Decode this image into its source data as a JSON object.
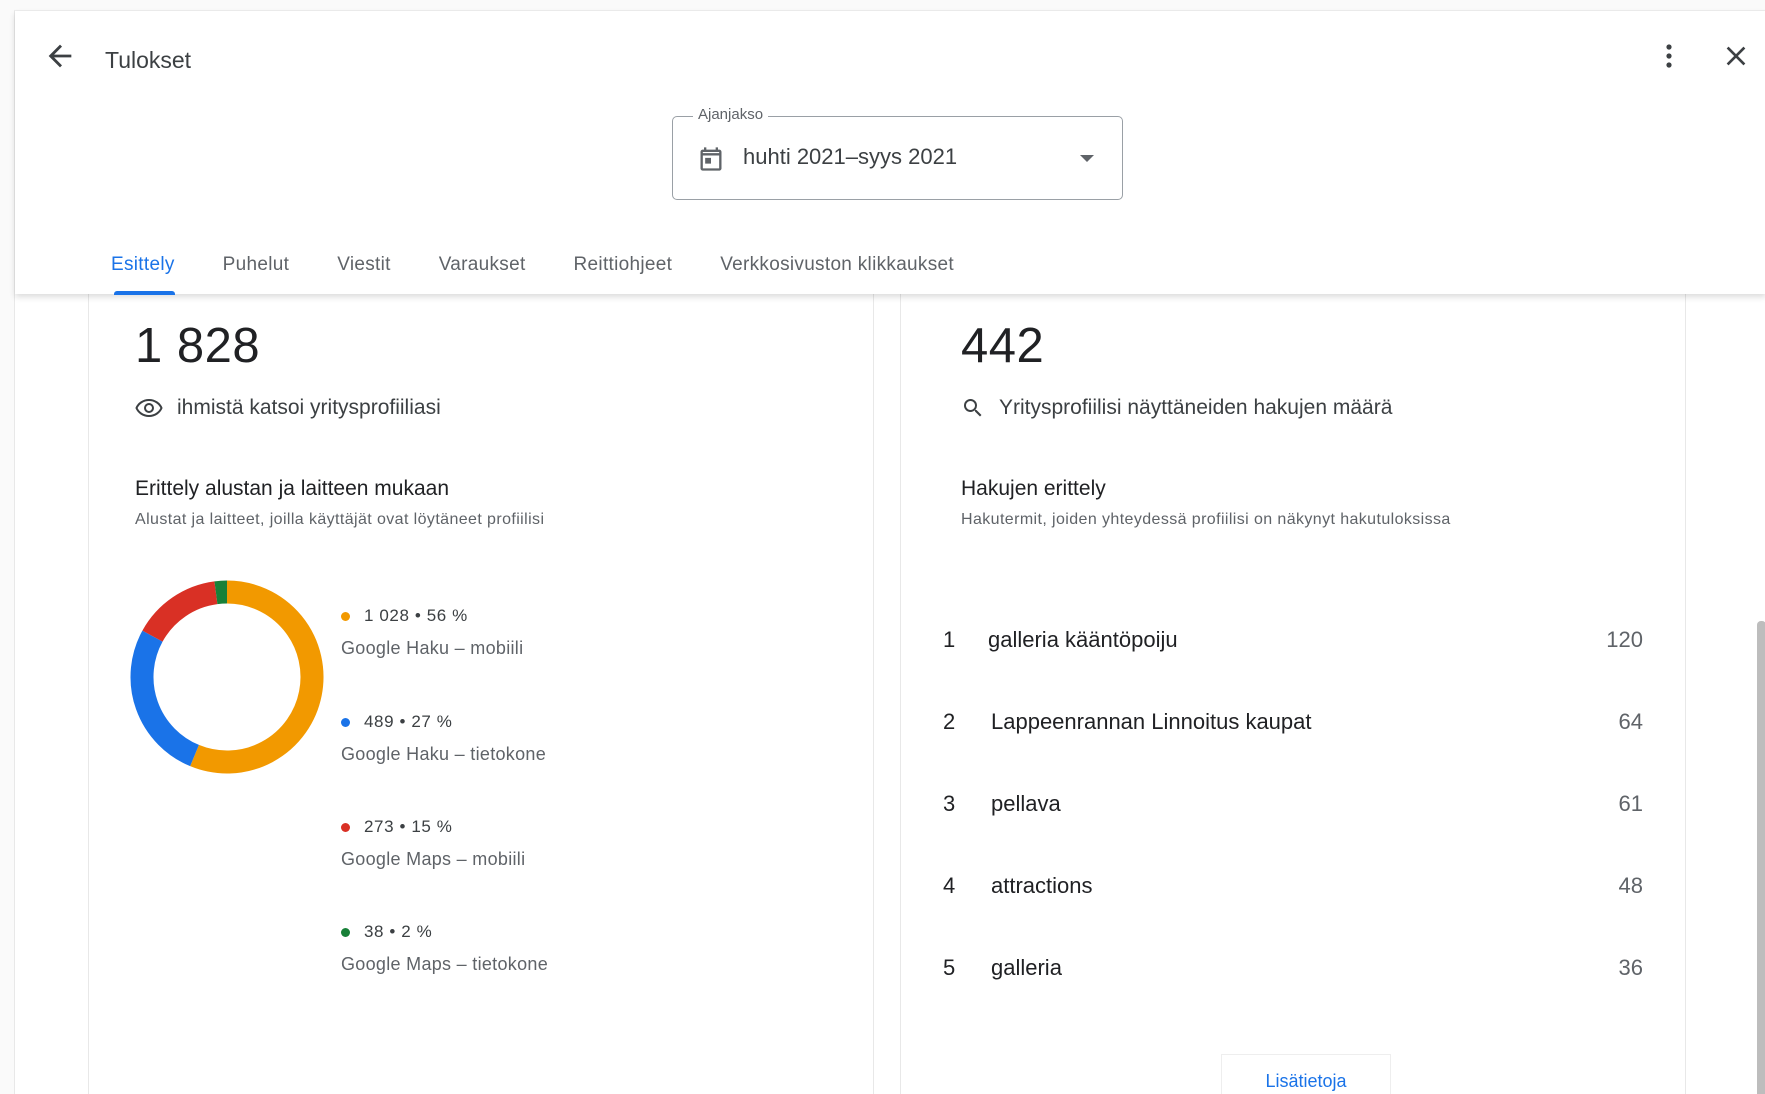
{
  "header": {
    "title": "Tulokset"
  },
  "period": {
    "label": "Ajanjakso",
    "value": "huhti 2021–syys 2021"
  },
  "tabs": [
    {
      "label": "Esittely",
      "active": true
    },
    {
      "label": "Puhelut",
      "active": false
    },
    {
      "label": "Viestit",
      "active": false
    },
    {
      "label": "Varaukset",
      "active": false
    },
    {
      "label": "Reittiohjeet",
      "active": false
    },
    {
      "label": "Verkkosivuston klikkaukset",
      "active": false
    }
  ],
  "profile_views": {
    "total": "1 828",
    "caption": "ihmistä katsoi yritysprofiiliasi",
    "breakdown_title": "Erittely alustan ja laitteen mukaan",
    "breakdown_subtitle": "Alustat ja laitteet, joilla käyttäjät ovat löytäneet profiilisi"
  },
  "searches": {
    "total": "442",
    "caption": "Yritysprofiilisi näyttäneiden hakujen määrä",
    "breakdown_title": "Hakujen erittely",
    "breakdown_subtitle": "Hakutermit, joiden yhteydessä profiilisi on näkynyt hakutuloksissa",
    "rows": [
      {
        "rank": "1",
        "term": "galleria kääntöpoiju",
        "count": "120"
      },
      {
        "rank": "2",
        "term": "Lappeenrannan Linnoitus kaupat",
        "count": "64"
      },
      {
        "rank": "3",
        "term": "pellava",
        "count": "61"
      },
      {
        "rank": "4",
        "term": "attractions",
        "count": "48"
      },
      {
        "rank": "5",
        "term": "galleria",
        "count": "36"
      }
    ],
    "more_link": "Lisätietoja"
  },
  "chart_data": {
    "type": "pie",
    "donut": true,
    "categories": [
      "Google Haku – mobiili",
      "Google Haku – tietokone",
      "Google Maps – mobiili",
      "Google Maps – tietokone"
    ],
    "values": [
      1028,
      489,
      273,
      38
    ],
    "percent": [
      56,
      27,
      15,
      2
    ],
    "value_labels": [
      "1 028 • 56 %",
      "489 • 27 %",
      "273 • 15 %",
      "38 • 2 %"
    ],
    "colors": [
      "#f29900",
      "#1a73e8",
      "#d93025",
      "#188038"
    ]
  }
}
